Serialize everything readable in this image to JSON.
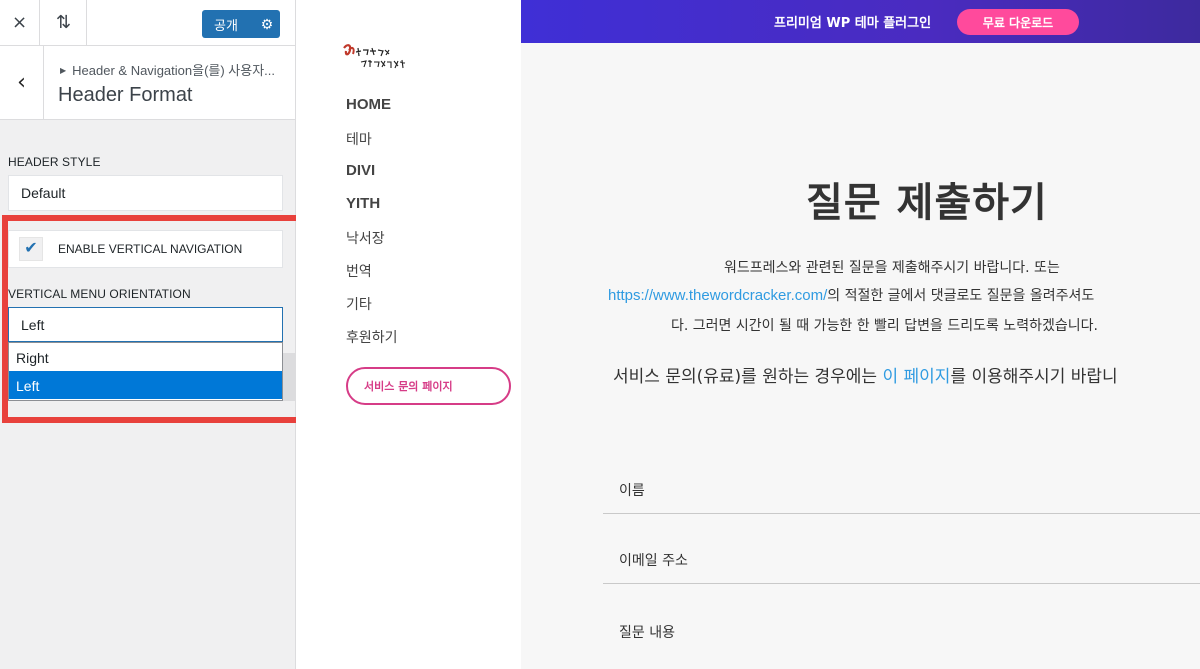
{
  "customizer": {
    "topbar": {
      "close_icon": "×",
      "reorder_icon": "⇅",
      "publish_label": "공개",
      "gear_icon": "⚙"
    },
    "header": {
      "back_icon": "‹",
      "breadcrumb": "Header & Navigation을(를) 사용자...",
      "section_title": "Header Format"
    },
    "header_style": {
      "label": "Header Style",
      "value": "Default"
    },
    "vertical_navigation": {
      "label": "Enable Vertical Navigation",
      "checked": true,
      "check_glyph": "✔"
    },
    "vertical_menu_orientation": {
      "label": "Vertical Menu Orientation",
      "value": "Left",
      "options": [
        "Right",
        "Left"
      ],
      "highlighted_option": "Left"
    },
    "highlight_color": "#e8413c"
  },
  "site_nav": {
    "items": [
      "HOME",
      "테마",
      "DIVI",
      "YITH",
      "낙서장",
      "번역",
      "기타",
      "후원하기"
    ],
    "service_button": "서비스 문의 페이지",
    "accent_color": "#d63c87"
  },
  "promo": {
    "text": "프리미엄 WP 테마 플러그인",
    "button": "무료 다운로드"
  },
  "page": {
    "title": "질문 제출하기",
    "intro_line1": "워드프레스와 관련된 질문을 제출해주시기 바랍니다. 또는",
    "intro_link": "https://www.thewordcracker.com/",
    "intro_line2_rest": "의 적절한 글에서 댓글로도 질문을 올려주셔도",
    "intro_line3": "다. 그러면 시간이 될 때 가능한 한 빨리 답변을 드리도록 노력하겠습니다.",
    "service_prefix": "서비스 문의(유료)를 원하는 경우에는 ",
    "service_link": "이 페이지",
    "service_suffix": "를 이용해주시기 바랍니",
    "form_fields": [
      "이름",
      "이메일 주소",
      "질문 내용"
    ],
    "link_color": "#2f9be1"
  }
}
